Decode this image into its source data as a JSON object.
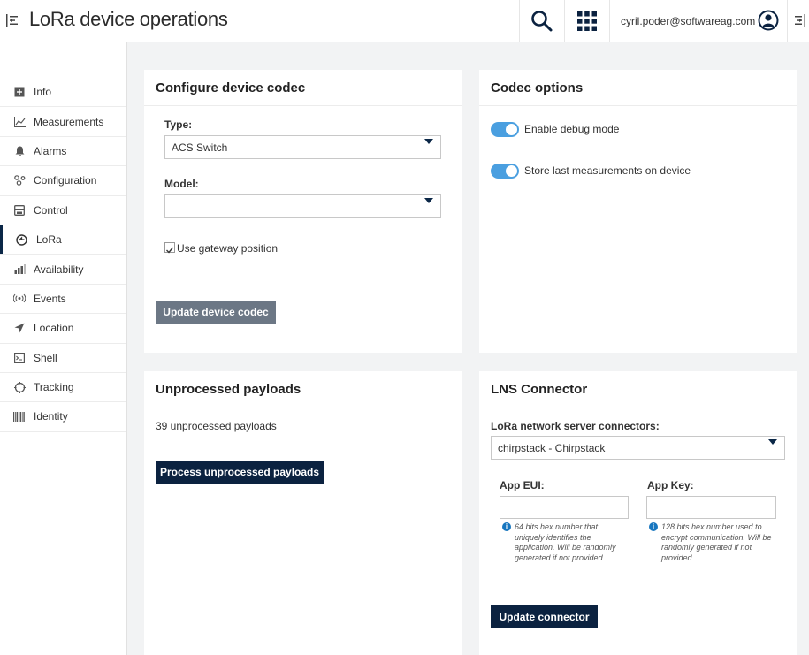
{
  "header": {
    "title": "LoRa device operations",
    "user_email": "cyril.poder@softwareag.com",
    "icons": [
      "menu-toggle-icon",
      "search-icon",
      "app-switcher-icon",
      "user-icon",
      "right-drawer-icon"
    ]
  },
  "sidebar": {
    "items": [
      {
        "label": "Info",
        "icon": "info-icon"
      },
      {
        "label": "Measurements",
        "icon": "measurements-icon"
      },
      {
        "label": "Alarms",
        "icon": "bell-icon"
      },
      {
        "label": "Configuration",
        "icon": "configuration-icon"
      },
      {
        "label": "Control",
        "icon": "control-icon"
      },
      {
        "label": "LoRa",
        "icon": "lora-icon",
        "active": true
      },
      {
        "label": "Availability",
        "icon": "availability-icon"
      },
      {
        "label": "Events",
        "icon": "events-icon"
      },
      {
        "label": "Location",
        "icon": "location-icon"
      },
      {
        "label": "Shell",
        "icon": "shell-icon"
      },
      {
        "label": "Tracking",
        "icon": "tracking-icon"
      },
      {
        "label": "Identity",
        "icon": "barcode-icon"
      }
    ]
  },
  "codec": {
    "title": "Configure device codec",
    "type_label": "Type:",
    "type_value": "ACS Switch",
    "model_label": "Model:",
    "model_value": "",
    "gateway_label": "Use gateway position",
    "gateway_checked": true,
    "update_button": "Update device codec"
  },
  "codec_options": {
    "title": "Codec options",
    "debug_label": "Enable debug mode",
    "debug_on": true,
    "store_label": "Store last measurements on device",
    "store_on": true
  },
  "unprocessed": {
    "title": "Unprocessed payloads",
    "count_text": "39 unprocessed payloads",
    "process_button": "Process unprocessed payloads"
  },
  "lns": {
    "title": "LNS Connector",
    "connectors_label": "LoRa network server connectors:",
    "connector_value": "chirpstack - Chirpstack",
    "app_eui_label": "App EUI:",
    "app_eui_value": "",
    "app_eui_help": "64 bits hex number that uniquely identifies the application. Will be randomly generated if not provided.",
    "app_key_label": "App Key:",
    "app_key_value": "",
    "app_key_help": "128 bits hex number used to encrypt communication. Will be randomly generated if not provided.",
    "update_button": "Update connector"
  },
  "colors": {
    "accent": "#0b2240",
    "toggle_on": "#4a9fe0",
    "info": "#1776bf"
  }
}
